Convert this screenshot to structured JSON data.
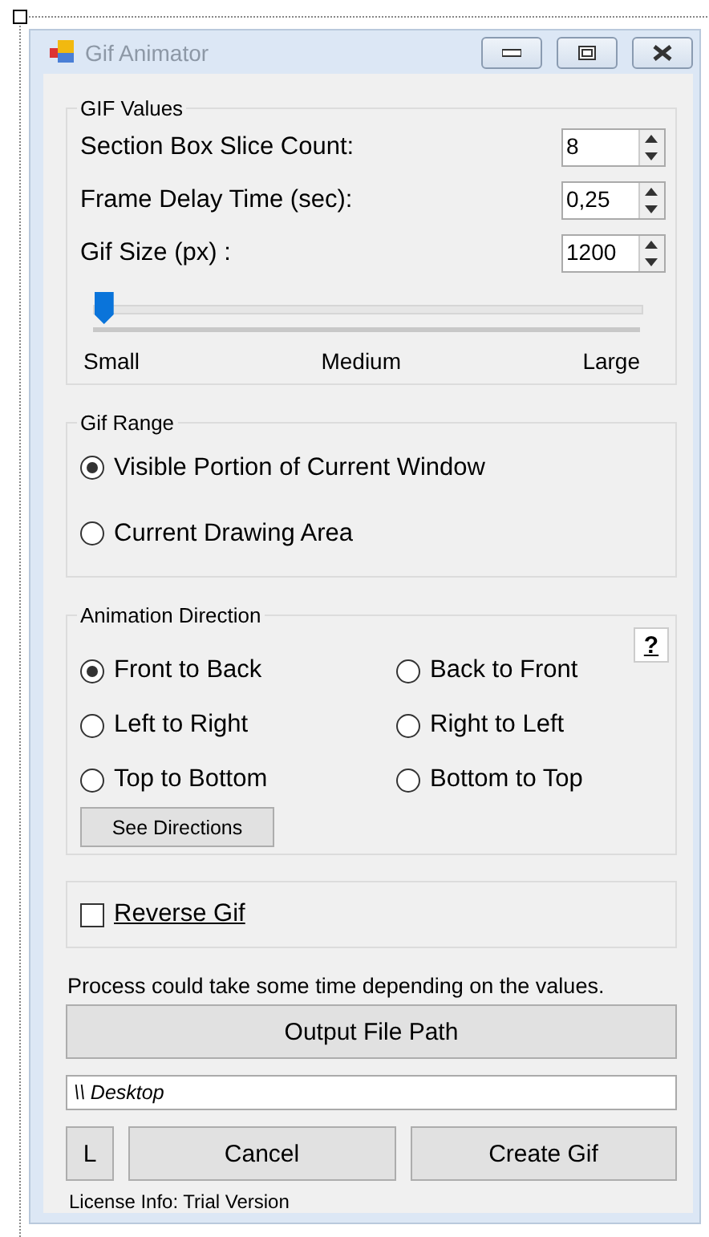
{
  "window": {
    "title": "Gif Animator"
  },
  "gif_values": {
    "title": "GIF Values",
    "fields": [
      {
        "label": "Section Box Slice Count:",
        "value": "8"
      },
      {
        "label": "Frame Delay Time (sec):",
        "value": "0,25"
      },
      {
        "label": "Gif Size (px) :",
        "value": "1200"
      }
    ],
    "size_slider": {
      "level": 0.02,
      "labels": [
        "Small",
        "Medium",
        "Large"
      ]
    }
  },
  "gif_range": {
    "title": "Gif Range",
    "options": [
      {
        "label": "Visible Portion of Current Window",
        "selected": true
      },
      {
        "label": "Current Drawing Area",
        "selected": false
      }
    ]
  },
  "animation_direction": {
    "title": "Animation Direction",
    "help": "?",
    "options": [
      {
        "label": "Front to Back",
        "selected": true
      },
      {
        "label": "Back to Front",
        "selected": false
      },
      {
        "label": "Left to Right",
        "selected": false
      },
      {
        "label": "Right to Left",
        "selected": false
      },
      {
        "label": "Top to Bottom",
        "selected": false
      },
      {
        "label": "Bottom to Top",
        "selected": false
      }
    ],
    "button": "See Directions"
  },
  "reverse_gif": {
    "label": "Reverse Gif",
    "checked": false
  },
  "note": "Process could take some time depending on the values.",
  "output_button": "Output File Path",
  "output_path": "\\\\ Desktop",
  "buttons": [
    {
      "label": "L"
    },
    {
      "label": "Cancel"
    },
    {
      "label": "Create Gif"
    }
  ],
  "license": "License Info: Trial Version"
}
